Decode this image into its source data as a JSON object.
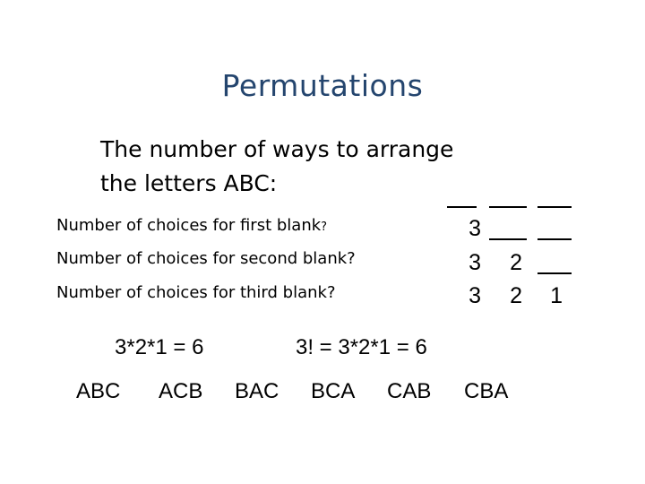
{
  "slide": {
    "title": "Permutations",
    "background_color": "#ffffff",
    "title_color": "#24456e",
    "text_color": "#000000"
  },
  "lead_in": {
    "line1": "The number of ways to arrange",
    "line2": "the letters ABC:"
  },
  "prompts": {
    "first": "Number of choices for first blank",
    "first_q": "?",
    "second": "Number of choices for second blank?",
    "third": "Number of choices for third blank?"
  },
  "blank_grid": {
    "rows": [
      {
        "cells": [
          {
            "type": "blank",
            "value": ""
          },
          {
            "type": "blank",
            "value": ""
          },
          {
            "type": "blank",
            "value": ""
          }
        ]
      },
      {
        "cells": [
          {
            "type": "digit",
            "value": "3"
          },
          {
            "type": "blank",
            "value": ""
          },
          {
            "type": "blank",
            "value": ""
          }
        ]
      },
      {
        "cells": [
          {
            "type": "digit",
            "value": "3"
          },
          {
            "type": "digit",
            "value": "2"
          },
          {
            "type": "blank",
            "value": ""
          }
        ]
      },
      {
        "cells": [
          {
            "type": "digit",
            "value": "3"
          },
          {
            "type": "digit",
            "value": "2"
          },
          {
            "type": "digit",
            "value": "1"
          }
        ]
      }
    ]
  },
  "equations": {
    "product": "3*2*1 = 6",
    "factorial": "3! = 3*2*1 = 6"
  },
  "permutations": {
    "items": [
      "ABC",
      "ACB",
      "BAC",
      "BCA",
      "CAB",
      "CBA"
    ],
    "count": 6
  }
}
